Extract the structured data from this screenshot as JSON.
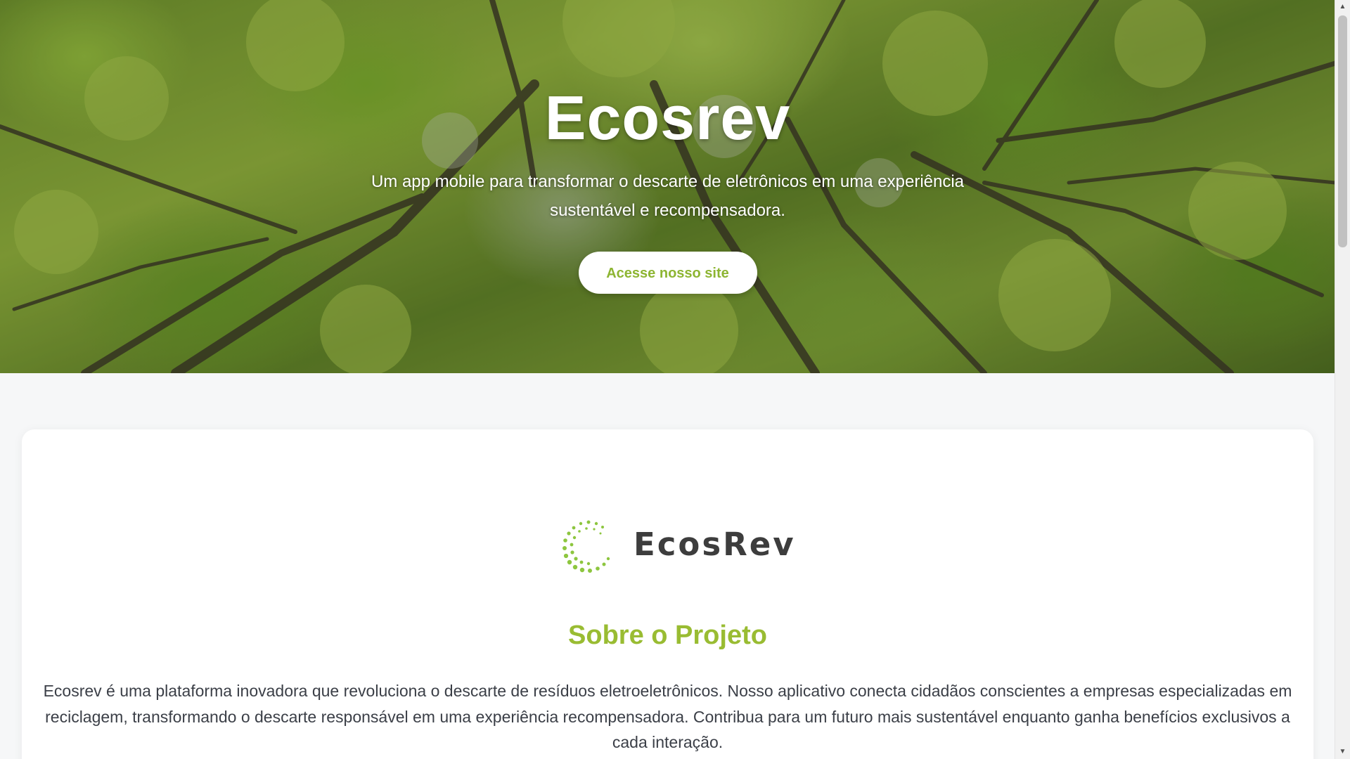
{
  "hero": {
    "title": "Ecosrev",
    "subtitle": "Um app mobile para transformar o descarte de eletrônicos em uma experiência sustentável e recompensadora.",
    "cta_label": "Acesse nosso site",
    "background_image": "forest-canopy-photo"
  },
  "about": {
    "logo_text": "EcosRev",
    "logo_icon": "dotted-circle-logo-icon",
    "title": "Sobre o Projeto",
    "body": "Ecosrev é uma plataforma inovadora que revoluciona o descarte de resíduos eletroeletrônicos. Nosso aplicativo conecta cidadãos conscientes a empresas especializadas em reciclagem, transformando o descarte responsável em uma experiência recompensadora. Contribua para um futuro mais sustentável enquanto ganha benefícios exclusivos a cada interação."
  },
  "colors": {
    "accent": "#99bc32",
    "button_text": "#8db532",
    "logo_text": "#3d3d3d",
    "body_text": "#3b3f47",
    "page_bg": "#f6f7f8"
  },
  "scrollbar": {
    "up_icon": "scroll-up-arrow-icon",
    "down_icon": "scroll-down-arrow-icon"
  }
}
